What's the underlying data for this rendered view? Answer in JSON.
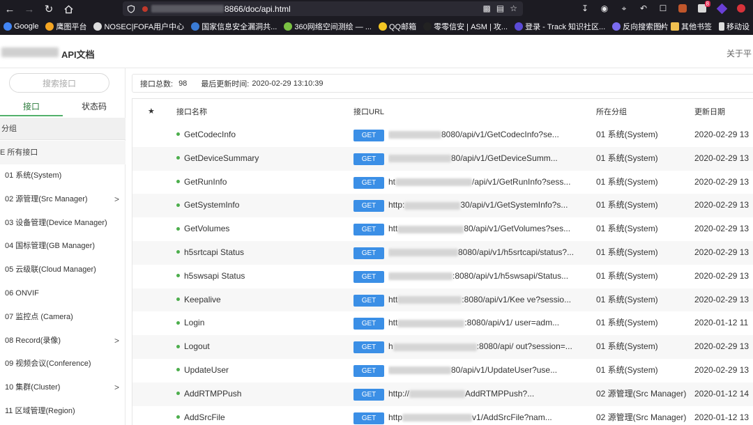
{
  "browser": {
    "url_suffix": "8866/doc/api.html",
    "bookmarks": [
      {
        "label": "Google",
        "color": "#4285f4"
      },
      {
        "label": "鹰图平台",
        "color": "#f5a623"
      },
      {
        "label": "NOSEC|FOFA用户中心",
        "color": "#dddddd"
      },
      {
        "label": "国家信息安全漏洞共...",
        "color": "#3a7bd5"
      },
      {
        "label": "360网络空间测绘 — ...",
        "color": "#7ac143"
      },
      {
        "label": "QQ邮箱",
        "color": "#f3c623"
      },
      {
        "label": "零零信安 | ASM | 攻...",
        "color": "#222222"
      },
      {
        "label": "登录 - Track 知识社区...",
        "color": "#5b4bd6"
      },
      {
        "label": "反向搜索图片",
        "color": "#7b6cf0"
      }
    ],
    "other_bookmarks": "其他书签",
    "mobile_bookmarks": "移动设",
    "toolbar_badge": "8"
  },
  "header": {
    "site_title": "API文档",
    "about": "关于平"
  },
  "sidebar": {
    "search_placeholder": "搜索接口",
    "tabs": [
      "接口",
      "状态码"
    ],
    "group_header": "分组",
    "all_apis": "E 所有接口",
    "items": [
      {
        "label": "01 系统(System)",
        "has_children": false
      },
      {
        "label": "02 源管理(Src Manager)",
        "has_children": true
      },
      {
        "label": "03 设备管理(Device Manager)",
        "has_children": false
      },
      {
        "label": "04 国标管理(GB Manager)",
        "has_children": false
      },
      {
        "label": "05 云级联(Cloud Manager)",
        "has_children": false
      },
      {
        "label": "06 ONVIF",
        "has_children": false
      },
      {
        "label": "07 监控点 (Camera)",
        "has_children": false
      },
      {
        "label": "08 Record(录像)",
        "has_children": true
      },
      {
        "label": "09 视频会议(Conference)",
        "has_children": false
      },
      {
        "label": "10 集群(Cluster)",
        "has_children": true
      },
      {
        "label": "11 区域管理(Region)",
        "has_children": false
      }
    ]
  },
  "info": {
    "total_label": "接口总数:",
    "total_value": "98",
    "updated_label": "最后更新时间:",
    "updated_value": "2020-02-29 13:10:39"
  },
  "table": {
    "headers": {
      "star": "★",
      "name": "接口名称",
      "url": "接口URL",
      "group": "所在分组",
      "date": "更新日期"
    },
    "rows": [
      {
        "name": "GetCodecInfo",
        "method": "GET",
        "url_prefix": "",
        "url_tail": "8080/api/v1/GetCodecInfo?se...",
        "group": "01 系统(System)",
        "date": "2020-02-29 13"
      },
      {
        "name": "GetDeviceSummary",
        "method": "GET",
        "url_prefix": "",
        "url_tail": "80/api/v1/GetDeviceSumm...",
        "group": "01 系统(System)",
        "date": "2020-02-29 13"
      },
      {
        "name": "GetRunInfo",
        "method": "GET",
        "url_prefix": "ht",
        "url_tail": "/api/v1/GetRunInfo?sess...",
        "group": "01 系统(System)",
        "date": "2020-02-29 13"
      },
      {
        "name": "GetSystemInfo",
        "method": "GET",
        "url_prefix": "http:",
        "url_tail": "30/api/v1/GetSystemInfo?s...",
        "group": "01 系统(System)",
        "date": "2020-02-29 13"
      },
      {
        "name": "GetVolumes",
        "method": "GET",
        "url_prefix": "htt",
        "url_tail": "80/api/v1/GetVolumes?ses...",
        "group": "01 系统(System)",
        "date": "2020-02-29 13"
      },
      {
        "name": "h5srtcapi Status",
        "method": "GET",
        "url_prefix": "",
        "url_tail": "8080/api/v1/h5srtcapi/status?...",
        "group": "01 系统(System)",
        "date": "2020-02-29 13"
      },
      {
        "name": "h5swsapi Status",
        "method": "GET",
        "url_prefix": "",
        "url_tail": ":8080/api/v1/h5swsapi/Status...",
        "group": "01 系统(System)",
        "date": "2020-02-29 13"
      },
      {
        "name": "Keepalive",
        "method": "GET",
        "url_prefix": "htt",
        "url_tail": ":8080/api/v1/Kee    ve?sessio...",
        "group": "01 系统(System)",
        "date": "2020-02-29 13"
      },
      {
        "name": "Login",
        "method": "GET",
        "url_prefix": "htt",
        "url_tail": ":8080/api/v1/      user=adm...",
        "group": "01 系统(System)",
        "date": "2020-01-12 11"
      },
      {
        "name": "Logout",
        "method": "GET",
        "url_prefix": "h",
        "url_tail": ":8080/api/    out?session=...",
        "group": "01 系统(System)",
        "date": "2020-02-29 13"
      },
      {
        "name": "UpdateUser",
        "method": "GET",
        "url_prefix": "",
        "url_tail": "80/api/v1/UpdateUser?use...",
        "group": "01 系统(System)",
        "date": "2020-02-29 13"
      },
      {
        "name": "AddRTMPPush",
        "method": "GET",
        "url_prefix": "http://",
        "url_tail": "AddRTMPPush?...",
        "group": "02 源管理(Src Manager)",
        "date": "2020-01-12 14"
      },
      {
        "name": "AddSrcFile",
        "method": "GET",
        "url_prefix": "http",
        "url_tail": "v1/AddSrcFile?nam...",
        "group": "02 源管理(Src Manager)",
        "date": "2020-01-12 13"
      }
    ]
  }
}
